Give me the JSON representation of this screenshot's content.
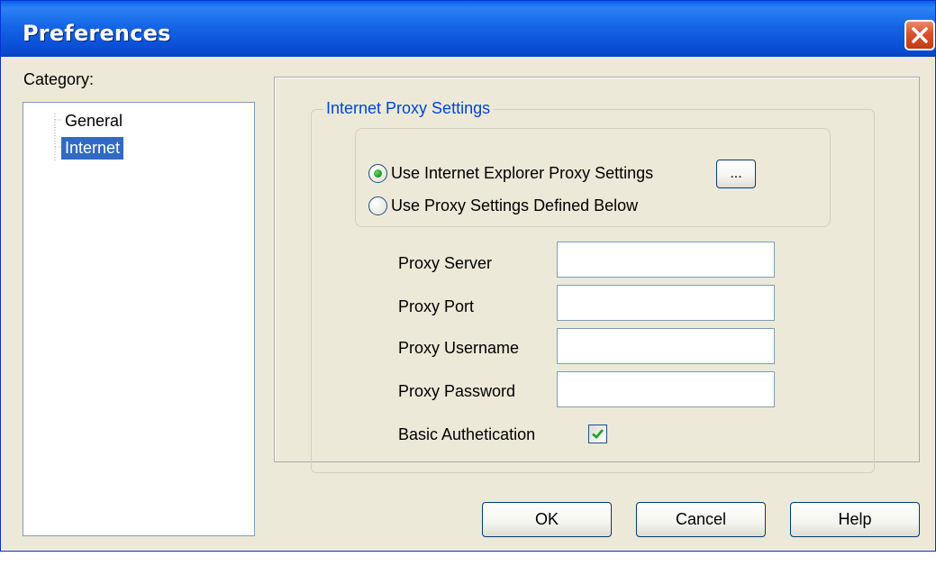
{
  "window": {
    "title": "Preferences"
  },
  "sidebar": {
    "label": "Category:",
    "items": [
      {
        "label": "General",
        "selected": false
      },
      {
        "label": "Internet",
        "selected": true
      }
    ]
  },
  "proxy": {
    "group_title": "Internet Proxy Settings",
    "radio_ie": "Use Internet Explorer Proxy Settings",
    "radio_custom": "Use Proxy Settings Defined Below",
    "selected_option": "ie",
    "browse_label": "...",
    "fields": [
      {
        "label": "Proxy Server",
        "value": ""
      },
      {
        "label": "Proxy Port",
        "value": ""
      },
      {
        "label": "Proxy Username",
        "value": ""
      },
      {
        "label": "Proxy Password",
        "value": ""
      }
    ],
    "basic_auth_label": "Basic Authetication",
    "basic_auth_checked": true
  },
  "buttons": {
    "ok": "OK",
    "cancel": "Cancel",
    "help": "Help"
  },
  "colors": {
    "titlebar": "#0a50d8",
    "selection": "#316ac5",
    "group_title": "#0046d5",
    "dialog_bg": "#ece9d8"
  }
}
